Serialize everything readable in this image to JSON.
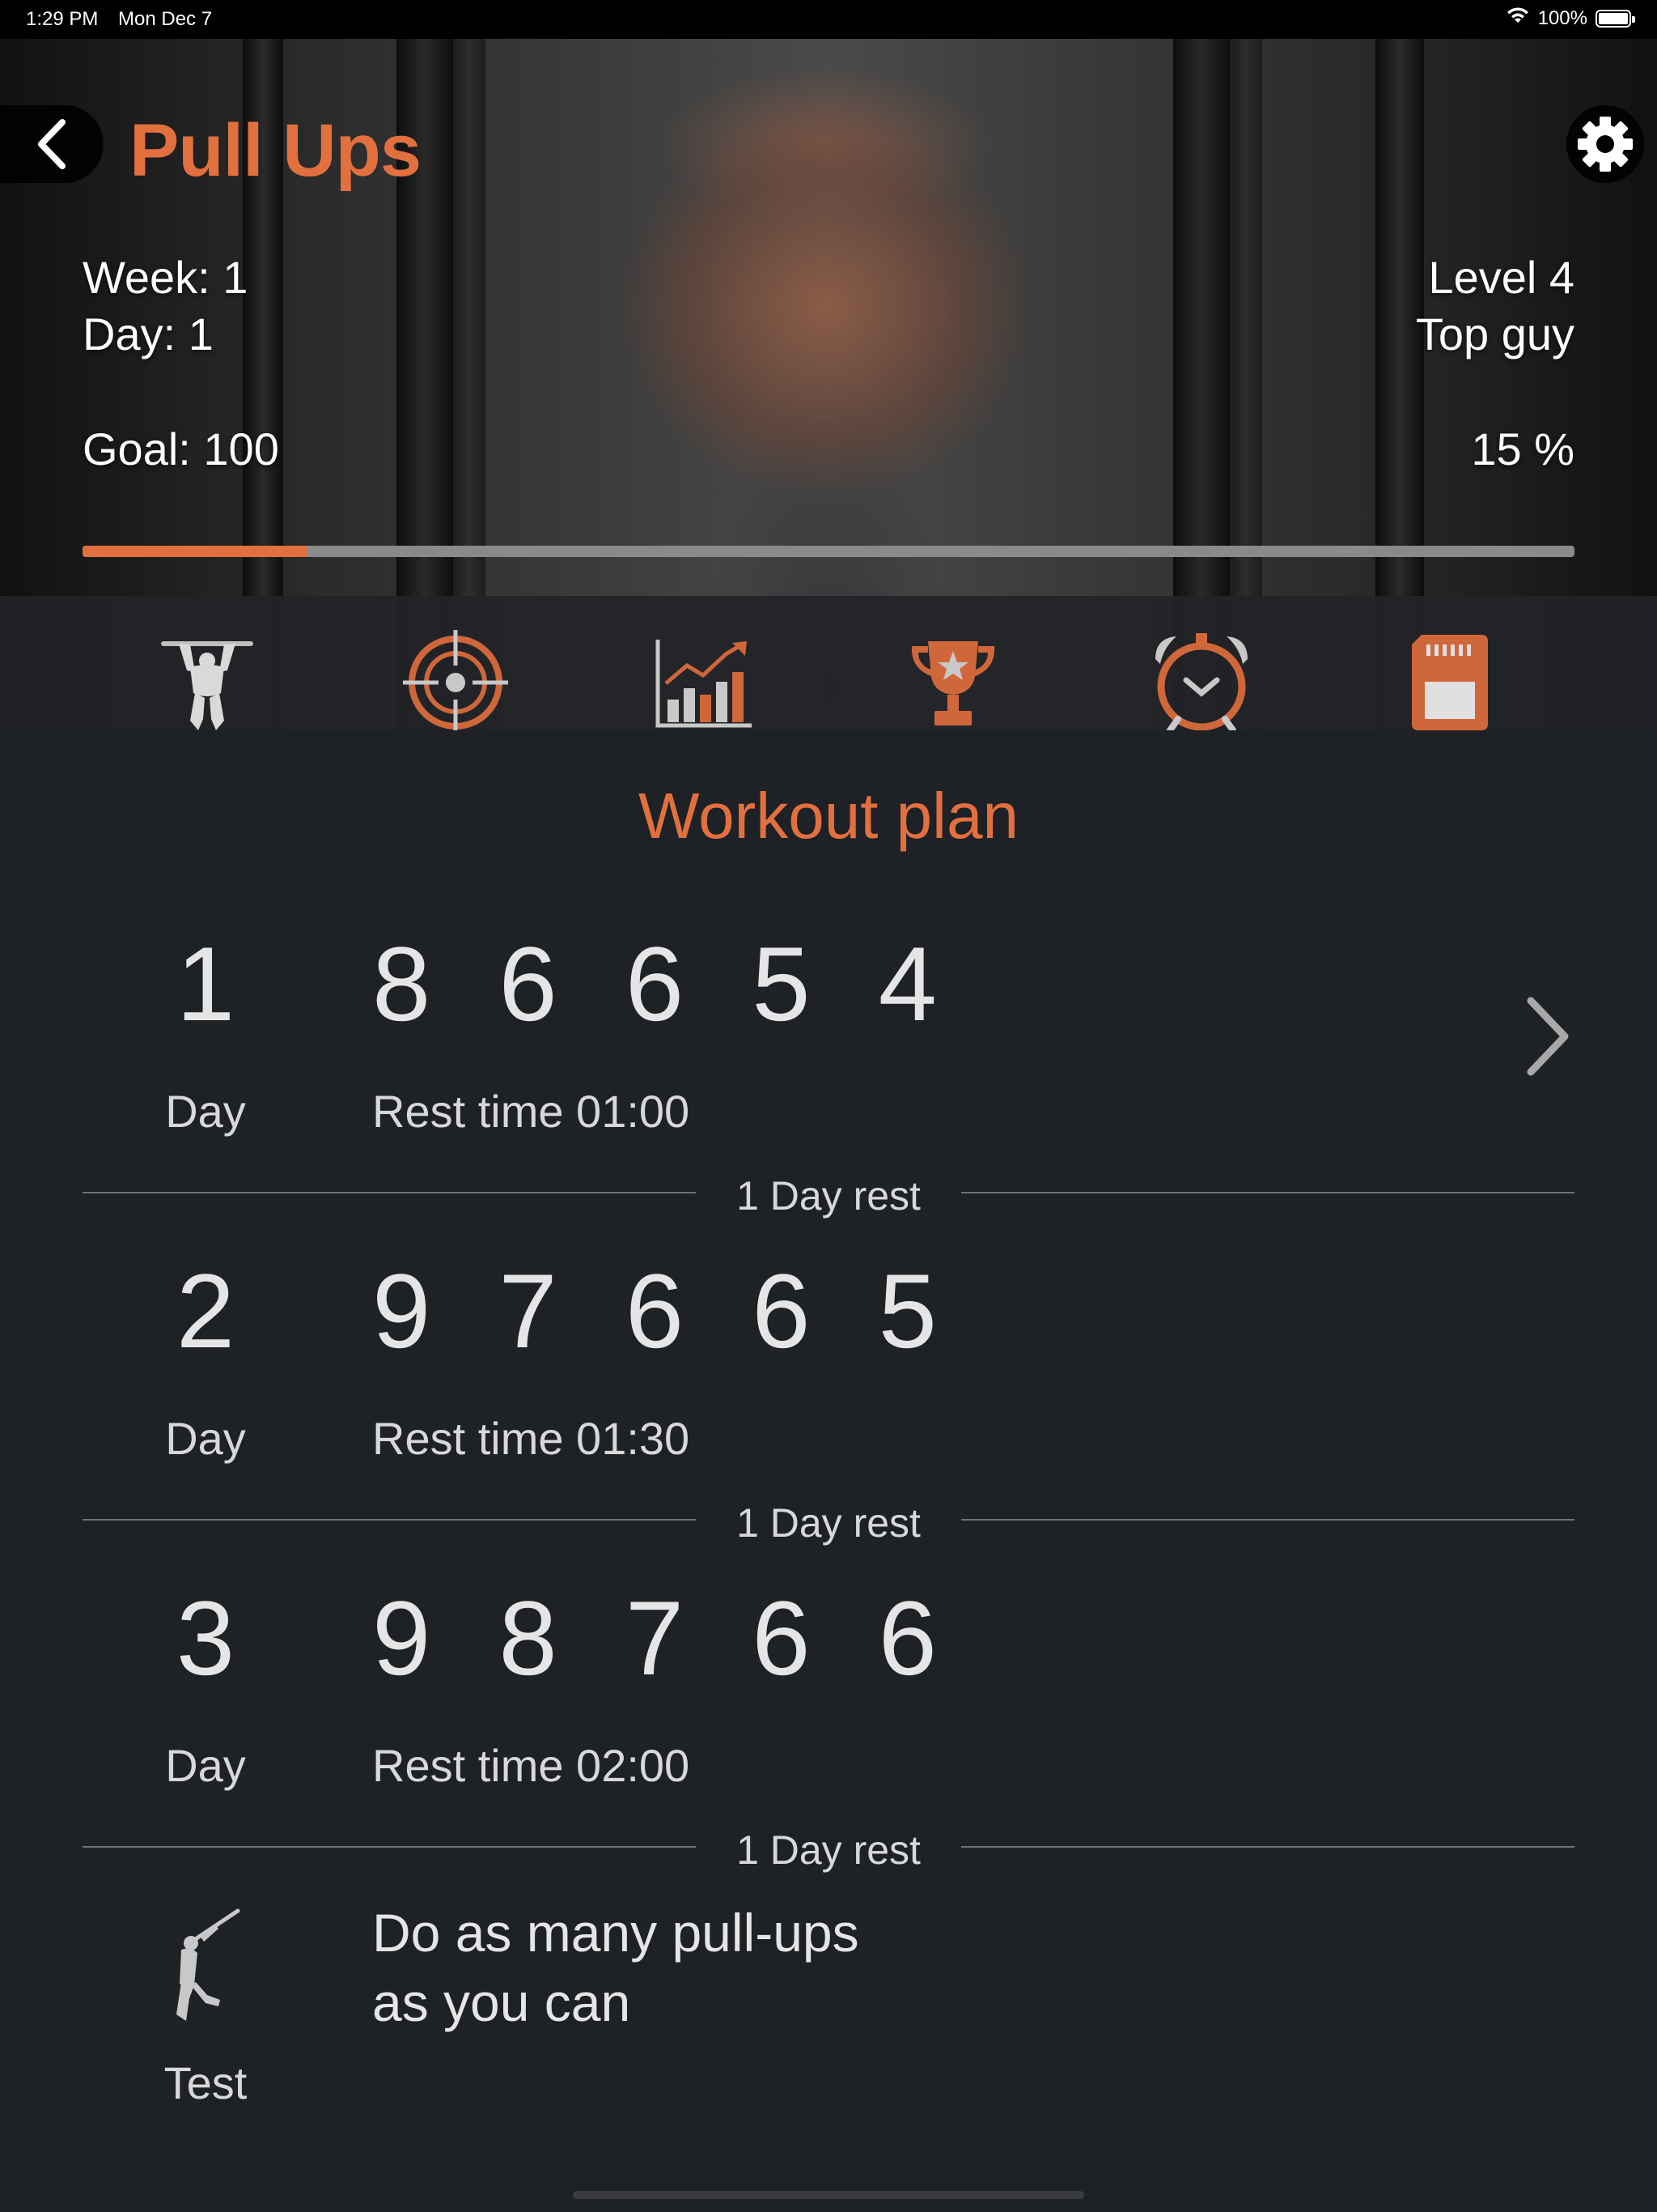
{
  "status_bar": {
    "time": "1:29 PM",
    "date": "Mon Dec 7",
    "battery": "100%"
  },
  "header": {
    "title": "Pull Ups",
    "week": "Week: 1",
    "day": "Day: 1",
    "level": "Level 4",
    "rank": "Top guy",
    "goal": "Goal: 100",
    "progress_text": "15 %",
    "progress_value": 0.15
  },
  "tabs": [
    {
      "icon": "pull-up-icon",
      "active": true
    },
    {
      "icon": "target-icon",
      "active": false
    },
    {
      "icon": "chart-icon",
      "active": false
    },
    {
      "icon": "trophy-icon",
      "active": false
    },
    {
      "icon": "alarm-clock-icon",
      "active": false
    },
    {
      "icon": "sd-card-icon",
      "active": false
    }
  ],
  "workout": {
    "title": "Workout plan",
    "days": [
      {
        "number": "1",
        "label": "Day",
        "reps": "8 6 6 5 4",
        "rest": "Rest time 01:00",
        "after": "1 Day rest"
      },
      {
        "number": "2",
        "label": "Day",
        "reps": "9 7 6 6 5",
        "rest": "Rest time 01:30",
        "after": "1 Day rest"
      },
      {
        "number": "3",
        "label": "Day",
        "reps": "9 8 7 6 6",
        "rest": "Rest time 02:00",
        "after": "1 Day rest"
      }
    ],
    "test": {
      "label": "Test",
      "line1": "Do as many pull-ups",
      "line2": "as you can"
    }
  },
  "colors": {
    "accent": "#e2703f",
    "background": "#1e2125",
    "text": "#e5e5e5"
  }
}
